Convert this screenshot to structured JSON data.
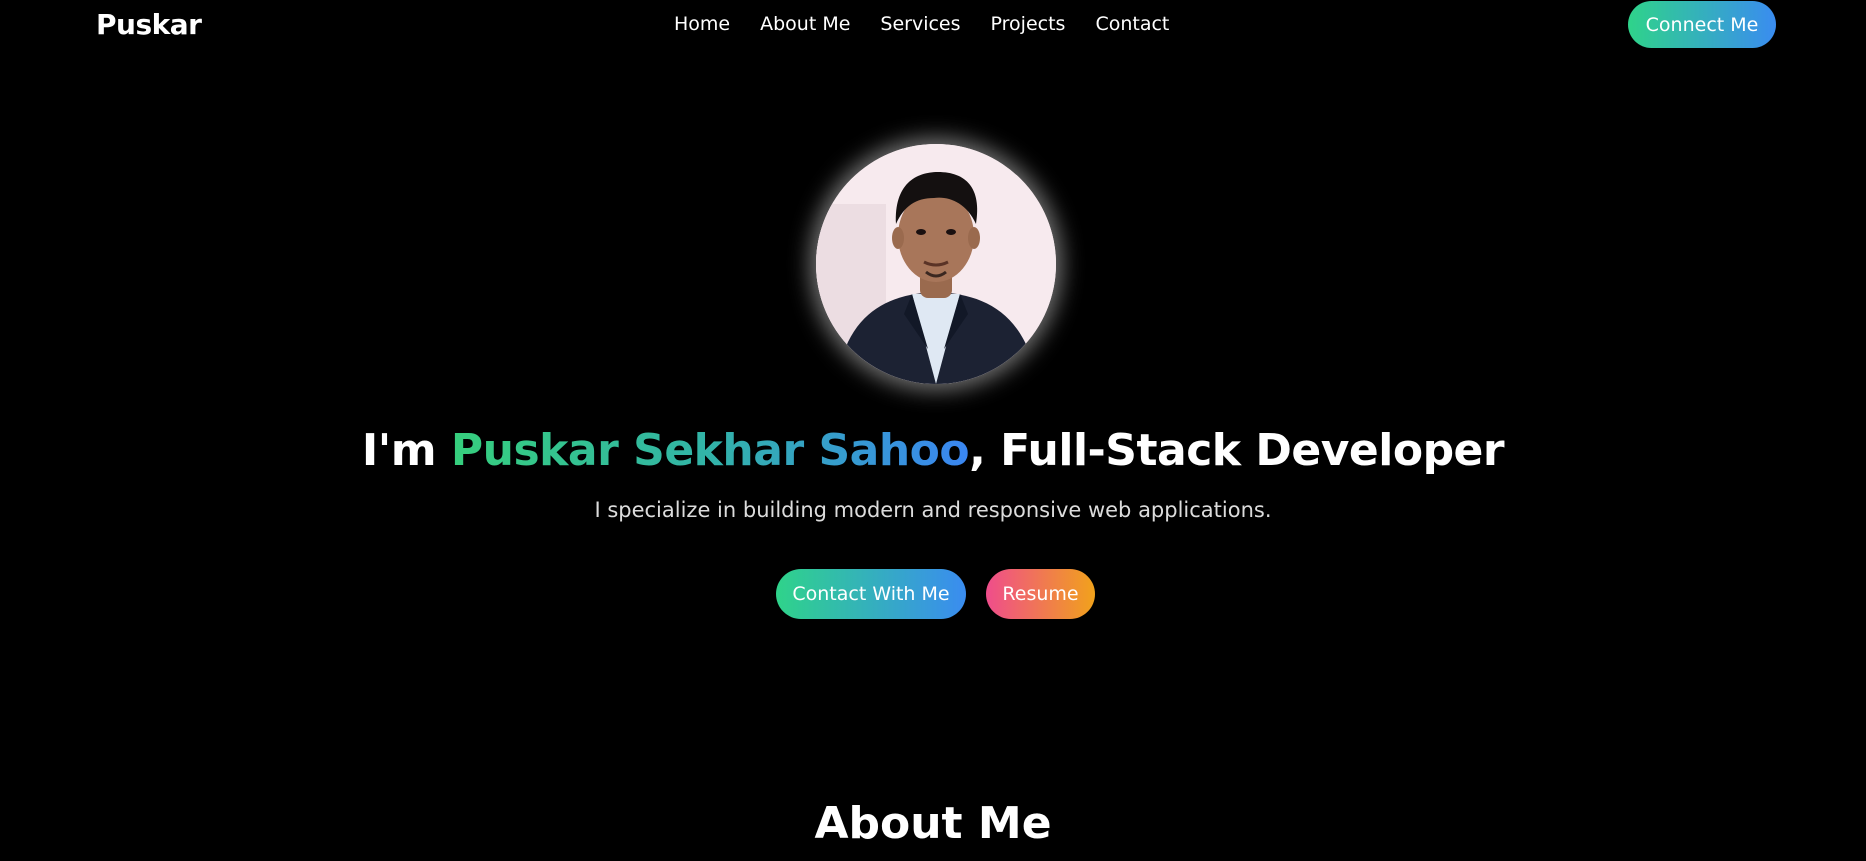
{
  "nav": {
    "brand": "Puskar",
    "links": [
      "Home",
      "About Me",
      "Services",
      "Projects",
      "Contact"
    ],
    "cta": "Connect Me"
  },
  "hero": {
    "headline_prefix": "I'm ",
    "headline_name": "Puskar Sekhar Sahoo",
    "headline_suffix": ", Full-Stack Developer",
    "subtitle": "I specialize in building modern and responsive web applications.",
    "primary_button": "Contact With Me",
    "secondary_button": "Resume"
  },
  "about": {
    "title": "About Me"
  },
  "colors": {
    "background": "#000000",
    "accent_green": "#2fd38a",
    "accent_blue": "#3a8cf0",
    "accent_pink": "#ef4d8c",
    "accent_orange": "#f1a21b"
  }
}
